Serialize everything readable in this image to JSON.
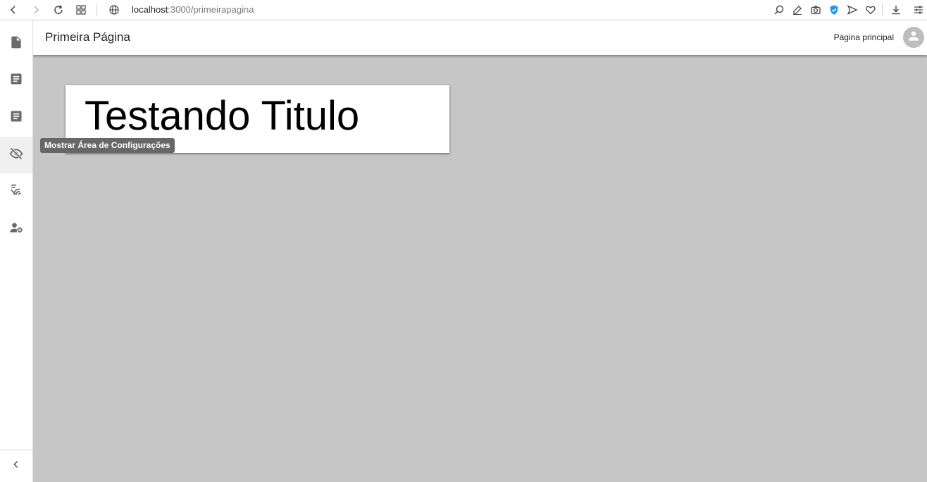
{
  "browser": {
    "url_host": "localhost",
    "url_path": ":3000/primeirapagina"
  },
  "header": {
    "title": "Primeira Página",
    "nav_link": "Página principal"
  },
  "card": {
    "title": "Testando Titulo"
  },
  "tooltip": {
    "text": "Mostrar Área de Configurações"
  },
  "sidebar": {
    "items": [
      {
        "icon": "file-icon"
      },
      {
        "icon": "article-icon"
      },
      {
        "icon": "article-icon"
      },
      {
        "icon": "visibility-off-icon",
        "active": true
      },
      {
        "icon": "wifi-tethering-off-icon"
      },
      {
        "icon": "manage-accounts-icon"
      }
    ],
    "collapse_icon": "chevron-left-icon"
  },
  "colors": {
    "content_bg": "#c6c6c6",
    "tooltip_bg": "#676767",
    "shield_blue": "#2196f3"
  }
}
